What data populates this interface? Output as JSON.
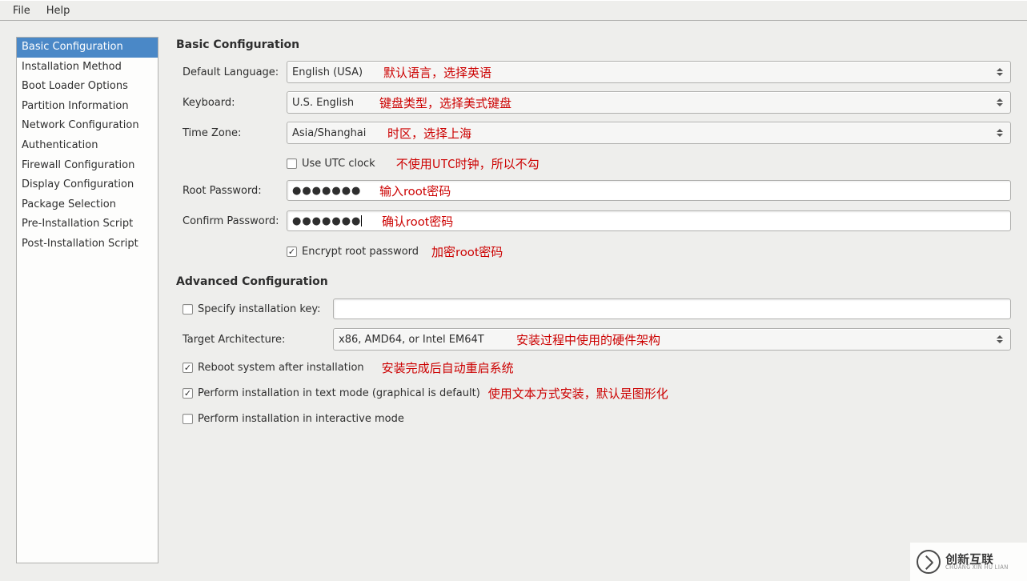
{
  "menu": {
    "file": "File",
    "help": "Help"
  },
  "sidebar": {
    "items": [
      "Basic Configuration",
      "Installation Method",
      "Boot Loader Options",
      "Partition Information",
      "Network Configuration",
      "Authentication",
      "Firewall Configuration",
      "Display Configuration",
      "Package Selection",
      "Pre-Installation Script",
      "Post-Installation Script"
    ],
    "selected_index": 0
  },
  "basic": {
    "title": "Basic Configuration",
    "default_language_label": "Default Language:",
    "default_language_value": "English (USA)",
    "default_language_note": "默认语言，选择英语",
    "keyboard_label": "Keyboard:",
    "keyboard_value": "U.S. English",
    "keyboard_note": "键盘类型，选择美式键盘",
    "timezone_label": "Time Zone:",
    "timezone_value": "Asia/Shanghai",
    "timezone_note": "时区，选择上海",
    "utc_label": "Use UTC clock",
    "utc_checked": false,
    "utc_note": "不使用UTC时钟，所以不勾",
    "root_pw_label": "Root Password:",
    "root_pw_value": "●●●●●●●",
    "root_pw_note": "输入root密码",
    "confirm_pw_label": "Confirm Password:",
    "confirm_pw_value": "●●●●●●●",
    "confirm_pw_note": "确认root密码",
    "encrypt_label": "Encrypt root password",
    "encrypt_checked": true,
    "encrypt_note": "加密root密码"
  },
  "advanced": {
    "title": "Advanced Configuration",
    "specify_key_label": "Specify installation key:",
    "specify_key_checked": false,
    "specify_key_value": "",
    "target_arch_label": "Target Architecture:",
    "target_arch_value": "x86, AMD64, or Intel EM64T",
    "target_arch_note": "安装过程中使用的硬件架构",
    "reboot_label": "Reboot system after installation",
    "reboot_checked": true,
    "reboot_note": "安装完成后自动重启系统",
    "textmode_label": "Perform installation in text mode (graphical is default)",
    "textmode_checked": true,
    "textmode_note": "使用文本方式安装，默认是图形化",
    "interactive_label": "Perform installation in interactive mode",
    "interactive_checked": false
  },
  "watermark": {
    "cn": "创新互联",
    "en": "CHUANG XIN HU LIAN"
  }
}
